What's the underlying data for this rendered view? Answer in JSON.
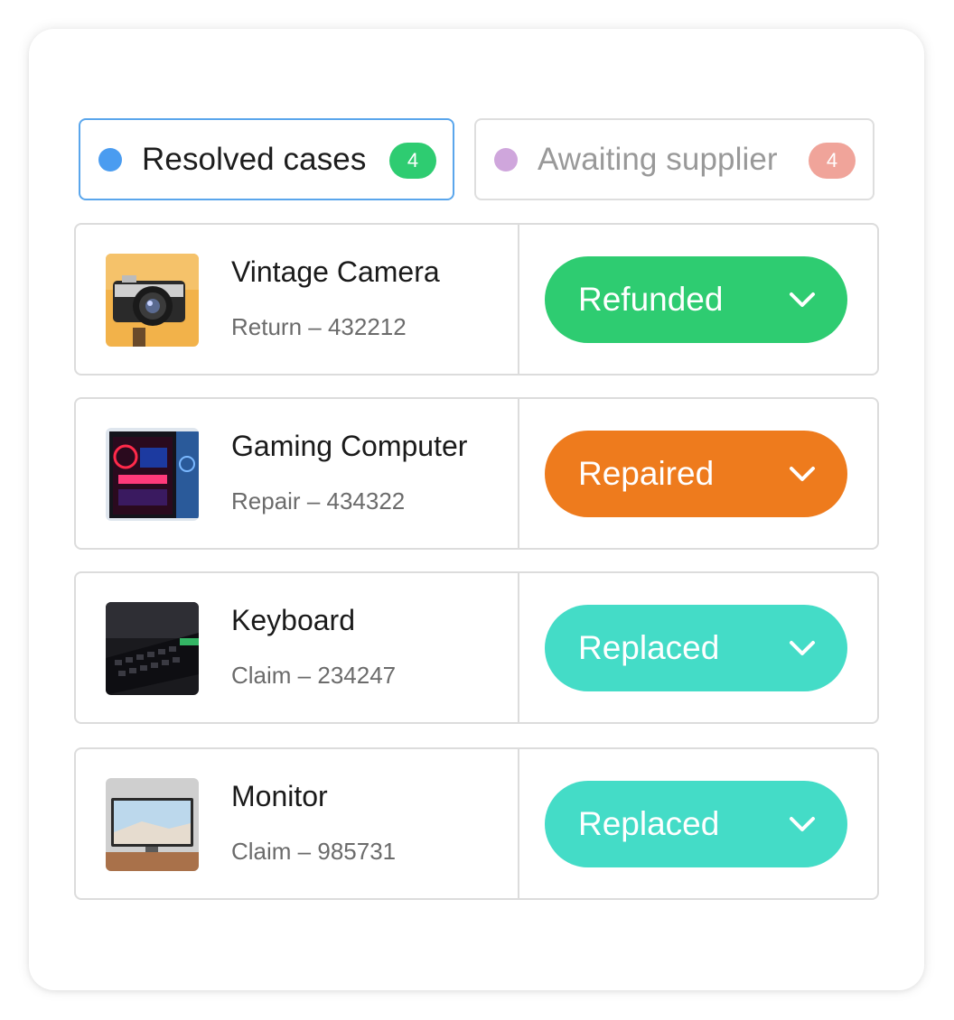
{
  "tabs": [
    {
      "label": "Resolved cases",
      "count": "4",
      "dot_color": "#4a9cf0",
      "count_color": "#2ecc71",
      "active": true
    },
    {
      "label": "Awaiting supplier",
      "count": "4",
      "dot_color": "#cfa6dc",
      "count_color": "#f0a49a",
      "active": false
    }
  ],
  "cases": [
    {
      "name": "Vintage Camera",
      "detail": "Return – 432212",
      "status": "Refunded",
      "status_color": "#2ecc71",
      "thumb_icon": "vintage-camera-photo"
    },
    {
      "name": "Gaming Computer",
      "detail": "Repair – 434322",
      "status": "Repaired",
      "status_color": "#ee7b1d",
      "thumb_icon": "gaming-computer-photo"
    },
    {
      "name": "Keyboard",
      "detail": "Claim – 234247",
      "status": "Replaced",
      "status_color": "#44dcc7",
      "thumb_icon": "keyboard-photo"
    },
    {
      "name": "Monitor",
      "detail": "Claim – 985731",
      "status": "Replaced",
      "status_color": "#44dcc7",
      "thumb_icon": "monitor-photo"
    }
  ]
}
